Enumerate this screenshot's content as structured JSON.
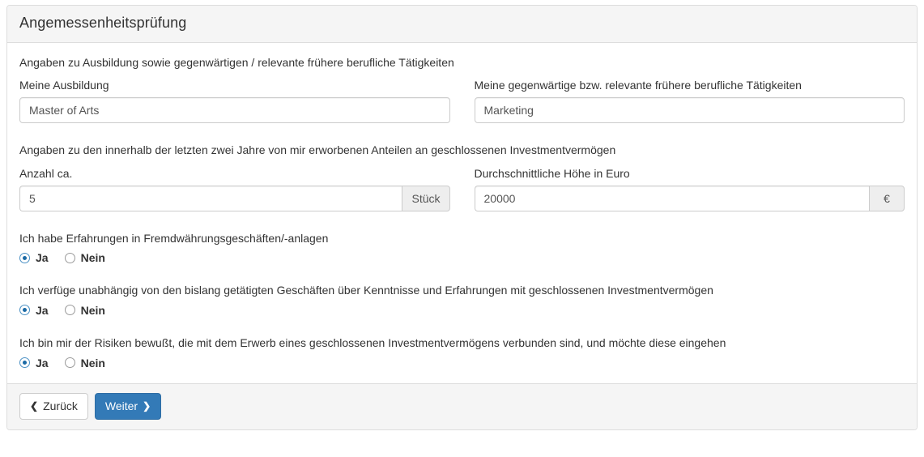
{
  "panel": {
    "title": "Angemessenheitsprüfung"
  },
  "education_section": {
    "heading": "Angaben zu Ausbildung sowie gegenwärtigen / relevante frühere berufliche Tätigkeiten",
    "fields": [
      {
        "label": "Meine Ausbildung",
        "value": "Master of Arts",
        "placeholder": "",
        "addon": ""
      },
      {
        "label": "Meine gegenwärtige bzw. relevante frühere berufliche Tätigkeiten",
        "value": "Marketing",
        "placeholder": "",
        "addon": ""
      }
    ]
  },
  "shares_section": {
    "heading": "Angaben zu den innerhalb der letzten zwei Jahre von mir erworbenen Anteilen an geschlossenen Investmentvermögen",
    "fields": [
      {
        "label": "Anzahl ca.",
        "value": "5",
        "placeholder": "",
        "addon": "Stück"
      },
      {
        "label": "Durchschnittliche Höhe in Euro",
        "value": "20000",
        "placeholder": "",
        "addon": "€"
      }
    ]
  },
  "questions": [
    {
      "text": "Ich habe Erfahrungen in Fremdwährungsgeschäften/-anlagen",
      "options": [
        {
          "label": "Ja",
          "selected": true
        },
        {
          "label": "Nein",
          "selected": false
        }
      ]
    },
    {
      "text": "Ich verfüge unabhängig von den bislang getätigten Geschäften über Kenntnisse und Erfahrungen mit geschlossenen Investmentvermögen",
      "options": [
        {
          "label": "Ja",
          "selected": true
        },
        {
          "label": "Nein",
          "selected": false
        }
      ]
    },
    {
      "text": "Ich bin mir der Risiken bewußt, die mit dem Erwerb eines geschlossenen Investmentvermögens verbunden sind, und möchte diese eingehen",
      "options": [
        {
          "label": "Ja",
          "selected": true
        },
        {
          "label": "Nein",
          "selected": false
        }
      ]
    }
  ],
  "footer": {
    "back_label": "Zurück",
    "back_icon": "chevron-left-icon",
    "next_label": "Weiter",
    "next_icon": "chevron-right-icon"
  },
  "colors": {
    "primary": "#337ab7",
    "primary_border": "#2e6da4",
    "panel_head_bg": "#f5f5f5",
    "border": "#dddddd",
    "input_border": "#cccccc",
    "addon_bg": "#eeeeee",
    "text": "#333333",
    "radio_dot": "#1b6aa5"
  }
}
